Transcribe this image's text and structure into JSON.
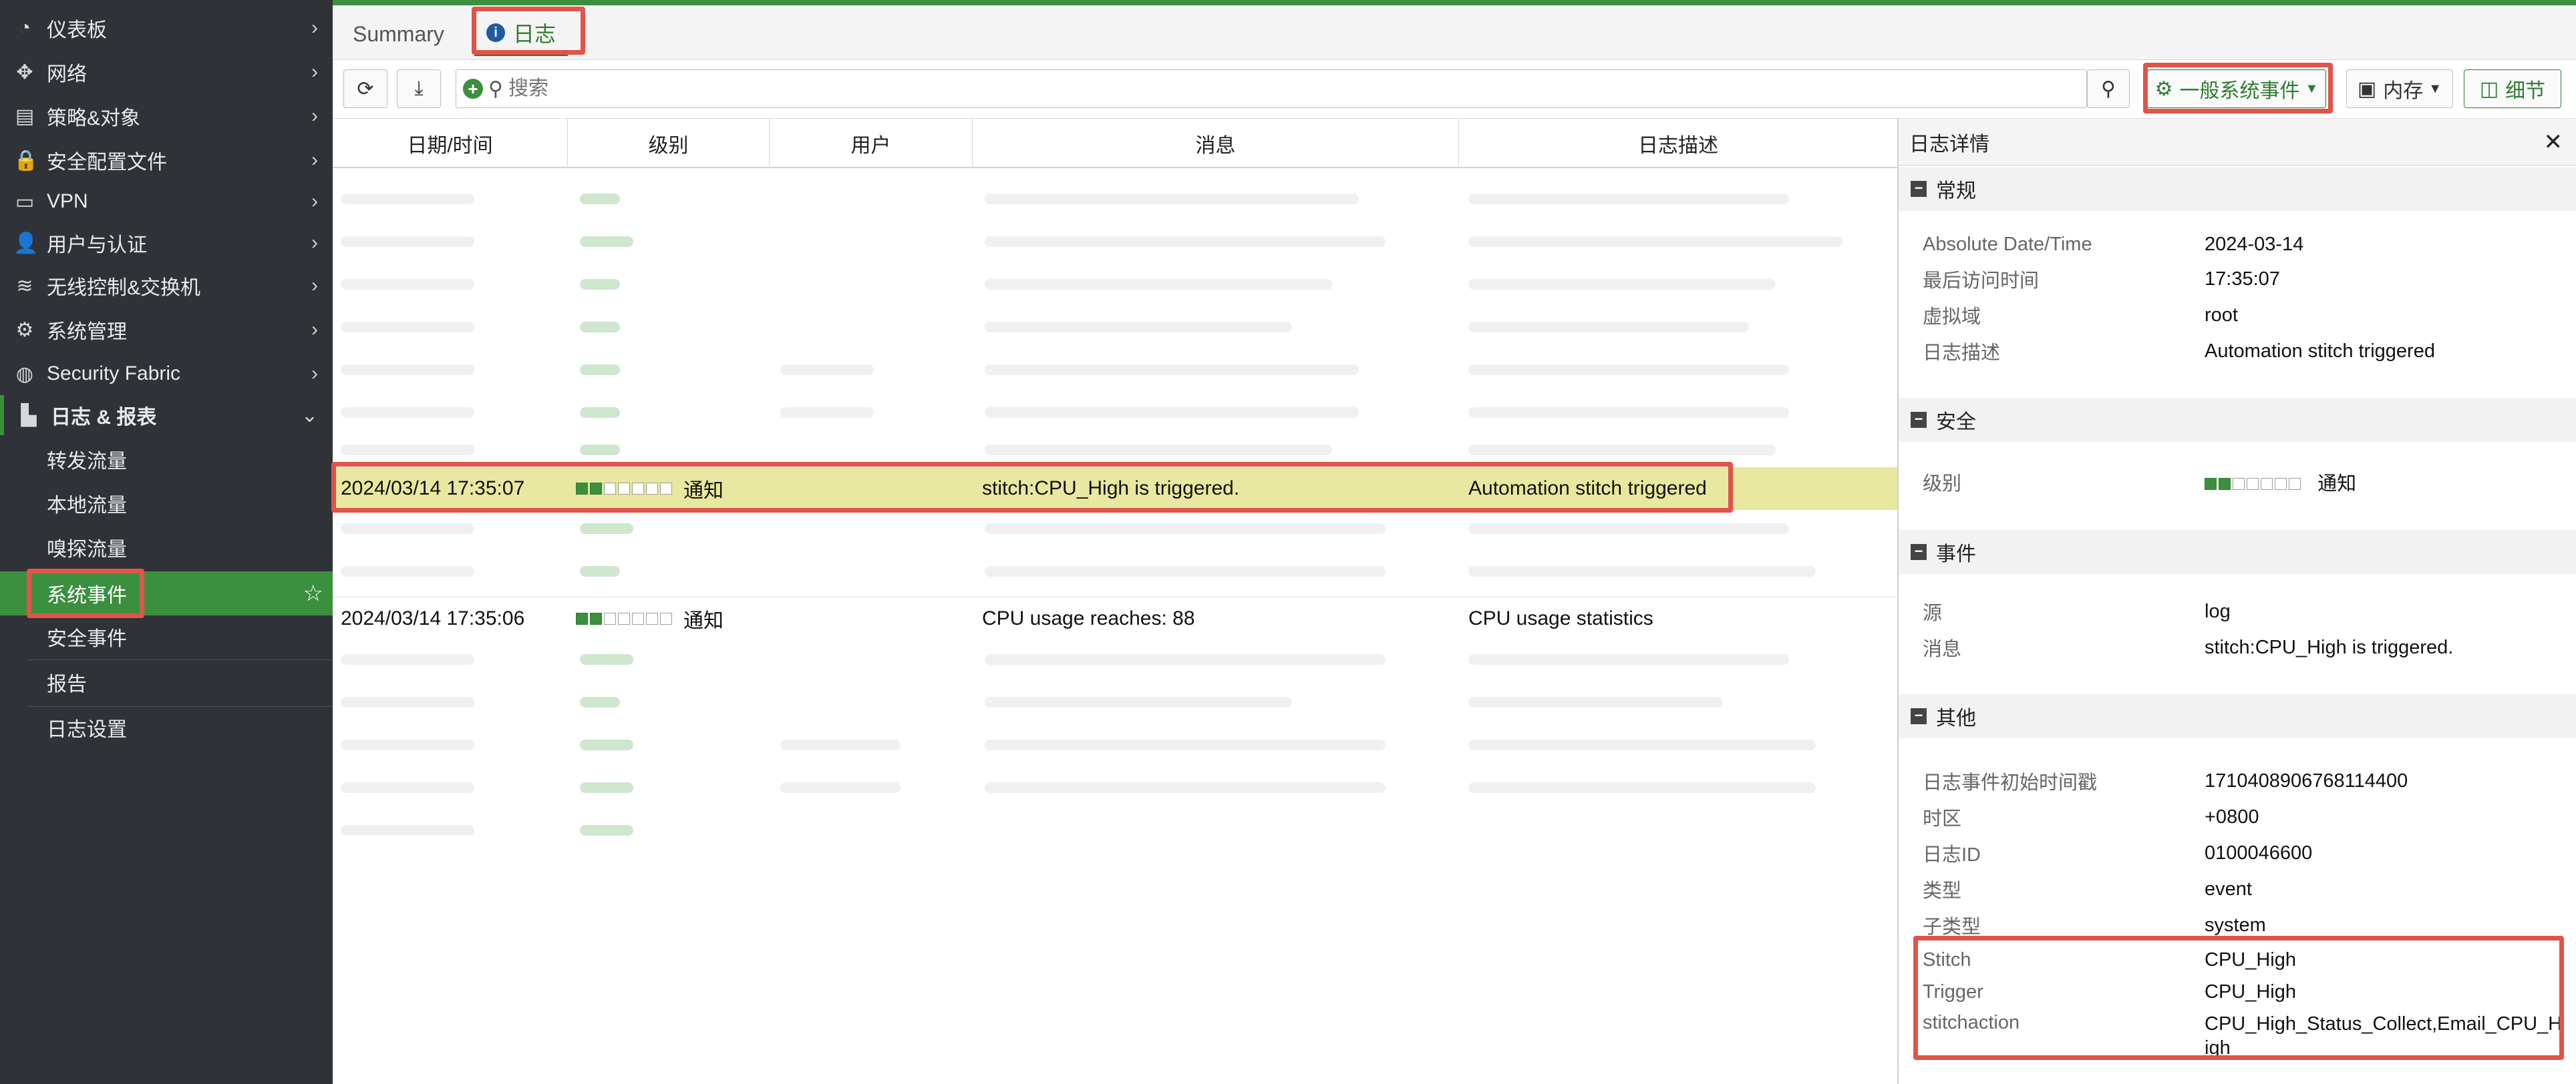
{
  "sidebar": {
    "items": [
      {
        "icon": "dashboard-icon",
        "label": "仪表板"
      },
      {
        "icon": "network-icon",
        "label": "网络"
      },
      {
        "icon": "policy-icon",
        "label": "策略&对象"
      },
      {
        "icon": "lock-icon",
        "label": "安全配置文件"
      },
      {
        "icon": "vpn-icon",
        "label": "VPN"
      },
      {
        "icon": "user-icon",
        "label": "用户与认证"
      },
      {
        "icon": "wifi-icon",
        "label": "无线控制&交换机"
      },
      {
        "icon": "gear-icon",
        "label": "系统管理"
      },
      {
        "icon": "fabric-icon",
        "label": "Security Fabric"
      },
      {
        "icon": "chart-icon",
        "label": "日志 & 报表"
      }
    ],
    "subitems": [
      {
        "label": "转发流量"
      },
      {
        "label": "本地流量"
      },
      {
        "label": "嗅探流量"
      },
      {
        "label": "系统事件"
      },
      {
        "label": "安全事件"
      },
      {
        "label": "报告"
      },
      {
        "label": "日志设置"
      }
    ]
  },
  "tabs": {
    "summary": "Summary",
    "log": "日志"
  },
  "toolbar": {
    "search_placeholder": "搜索",
    "event_type": "一般系统事件",
    "storage": "内存",
    "details": "细节"
  },
  "table": {
    "columns": [
      "日期/时间",
      "级别",
      "用户",
      "消息",
      "日志描述"
    ],
    "rows": [
      {
        "datetime": "2024/03/14 17:35:07",
        "level": "通知",
        "level_bars": 2,
        "user": "",
        "message": "stitch:CPU_High is triggered.",
        "description": "Automation stitch triggered",
        "selected": true
      },
      {
        "datetime": "2024/03/14 17:35:06",
        "level": "通知",
        "level_bars": 2,
        "user": "",
        "message": "CPU usage reaches: 88",
        "description": "CPU usage statistics",
        "selected": false
      }
    ]
  },
  "detail": {
    "title": "日志详情",
    "sections": {
      "general": {
        "title": "常规",
        "fields": [
          {
            "key": "Absolute Date/Time",
            "value": "2024-03-14"
          },
          {
            "key": "最后访问时间",
            "value": "17:35:07"
          },
          {
            "key": "虚拟域",
            "value": "root"
          },
          {
            "key": "日志描述",
            "value": "Automation stitch triggered"
          }
        ]
      },
      "security": {
        "title": "安全",
        "fields": [
          {
            "key": "级别",
            "value": "通知",
            "level_bars": 2
          }
        ]
      },
      "event": {
        "title": "事件",
        "fields": [
          {
            "key": "源",
            "value": "log"
          },
          {
            "key": "消息",
            "value": "stitch:CPU_High is triggered."
          }
        ]
      },
      "other": {
        "title": "其他",
        "fields": [
          {
            "key": "日志事件初始时间戳",
            "value": "1710408906768114400"
          },
          {
            "key": "时区",
            "value": "+0800"
          },
          {
            "key": "日志ID",
            "value": "0100046600"
          },
          {
            "key": "类型",
            "value": "event"
          },
          {
            "key": "子类型",
            "value": "system"
          },
          {
            "key": "Stitch",
            "value": "CPU_High"
          },
          {
            "key": "Trigger",
            "value": "CPU_High"
          },
          {
            "key": "stitchaction",
            "value": "CPU_High_Status_Collect,Email_CPU_High"
          }
        ]
      }
    }
  },
  "colors": {
    "accent": "#3c8f3f",
    "highlight": "#e0544a",
    "selected_row": "#e8e8a0"
  }
}
